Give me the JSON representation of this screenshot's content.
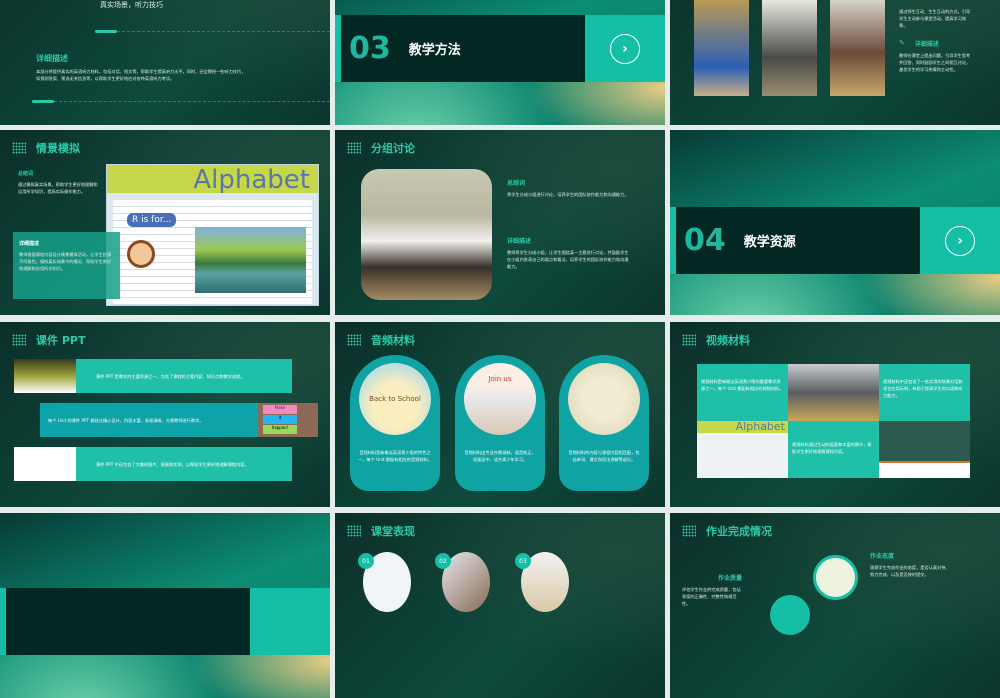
{
  "slide1": {
    "top_text": "真实场景，听力技巧",
    "detail_title": "详细描述",
    "detail_text": "本部分将提供真实的英语听力材料，包括对话、短文等，帮助学生提高听力水平。同时，还会教授一些听力技巧，如预测答案、筛选无关信息等，以帮助学生更好地应对各种英语听力考试。"
  },
  "slide2": {
    "number": "03",
    "title": "教学方法",
    "arrow": "›"
  },
  "slide3": {
    "text1": "通过师生互动、生生互动的方式，引导学生主动参与课堂活动，提高学习效果。",
    "detail_title": "详细描述",
    "detail_text": "教师在课堂上提出问题，引导学生思考并回答，同时鼓励学生之间相互讨论，激发学生的学习热情和主动性。"
  },
  "slide4": {
    "title": "情景模拟",
    "summary_title": "总结词",
    "summary_text": "通过模拟真实场景，帮助学生更好地理解和运用所学知识，提高实际操作能力。",
    "detail_title": "详细描述",
    "detail_text": "教师根据课程内容设计情景模拟活动，让学生扮演不同角色，模拟真实场景中的情况，帮助学生更好地理解和应用所学知识。",
    "image_text_1": "Alphabet",
    "image_text_2": "R is for..."
  },
  "slide5": {
    "title": "分组讨论",
    "summary_title": "总结词",
    "summary_text": "将学生分成小组进行讨论，培养学生的团队协作能力和沟通能力。",
    "detail_title": "详细描述",
    "detail_text": "教师将学生分成小组，让学生围绕某一主题进行讨论，并鼓励学生在小组内发表自己的观点和看法，培养学生的团队协作能力和沟通能力。"
  },
  "slide6": {
    "number": "04",
    "title": "教学资源",
    "arrow": "›"
  },
  "slide7": {
    "title": "课件 PPT",
    "rows": [
      "课件 PPT 是教学的主要资源之一，包含了课程的主要内容、知识点和教学流程。",
      "每个 Unit 的课件 PPT 都经过精心设计，内容丰富、条理清晰，方便教师进行教学。",
      "课件 PPT 中还包含了大量的图片、图表和实例，以帮助学生更好地理解课程内容。"
    ],
    "notes": [
      "Make",
      "it",
      "happen!"
    ]
  },
  "slide8": {
    "title": "音频材料",
    "cards": [
      {
        "caption": "Back to School",
        "text": "音频材料是新概念英语青少版的特色之一，每个 Unit 都配有相应的音频材料。"
      },
      {
        "caption": "Join us",
        "text": "音频材料由专业外教录制，语音纯正，语速适中，适合青少年学习。"
      },
      {
        "caption": "",
        "text": "音频材料的内容与课程内容相匹配，包括单词、课文和语法讲解等部分。"
      }
    ]
  },
  "slide9": {
    "title": "视频材料",
    "texts": [
      "视频材料是新概念英语青少版的重要教学资源之一，每个 Unit 都配有相应的视频材料。",
      "视频材料中还包含了一些实用的场景对话和语言应用示例，有助于提高学生的口语和听力能力。",
      "视频材料通过生动的画面和丰富的情节，帮助学生更好地理解课程内容。"
    ],
    "image_text": "Alphabet"
  },
  "slide10": {},
  "slide11": {
    "title": "课堂表现",
    "items": [
      "01",
      "02",
      "03"
    ]
  },
  "slide12": {
    "title": "作业完成情况",
    "quality_title": "作业质量",
    "quality_text": "评估学生作业的完成质量，包括答案的正确性、完整性和规范性。",
    "attitude_title": "作业态度",
    "attitude_text": "观察学生完成作业的态度，是否认真对待、努力完成，以及是否按时提交。"
  },
  "colors": {
    "accent": "#14bfa6",
    "dark": "#032823",
    "gap": "#e6ecea"
  }
}
